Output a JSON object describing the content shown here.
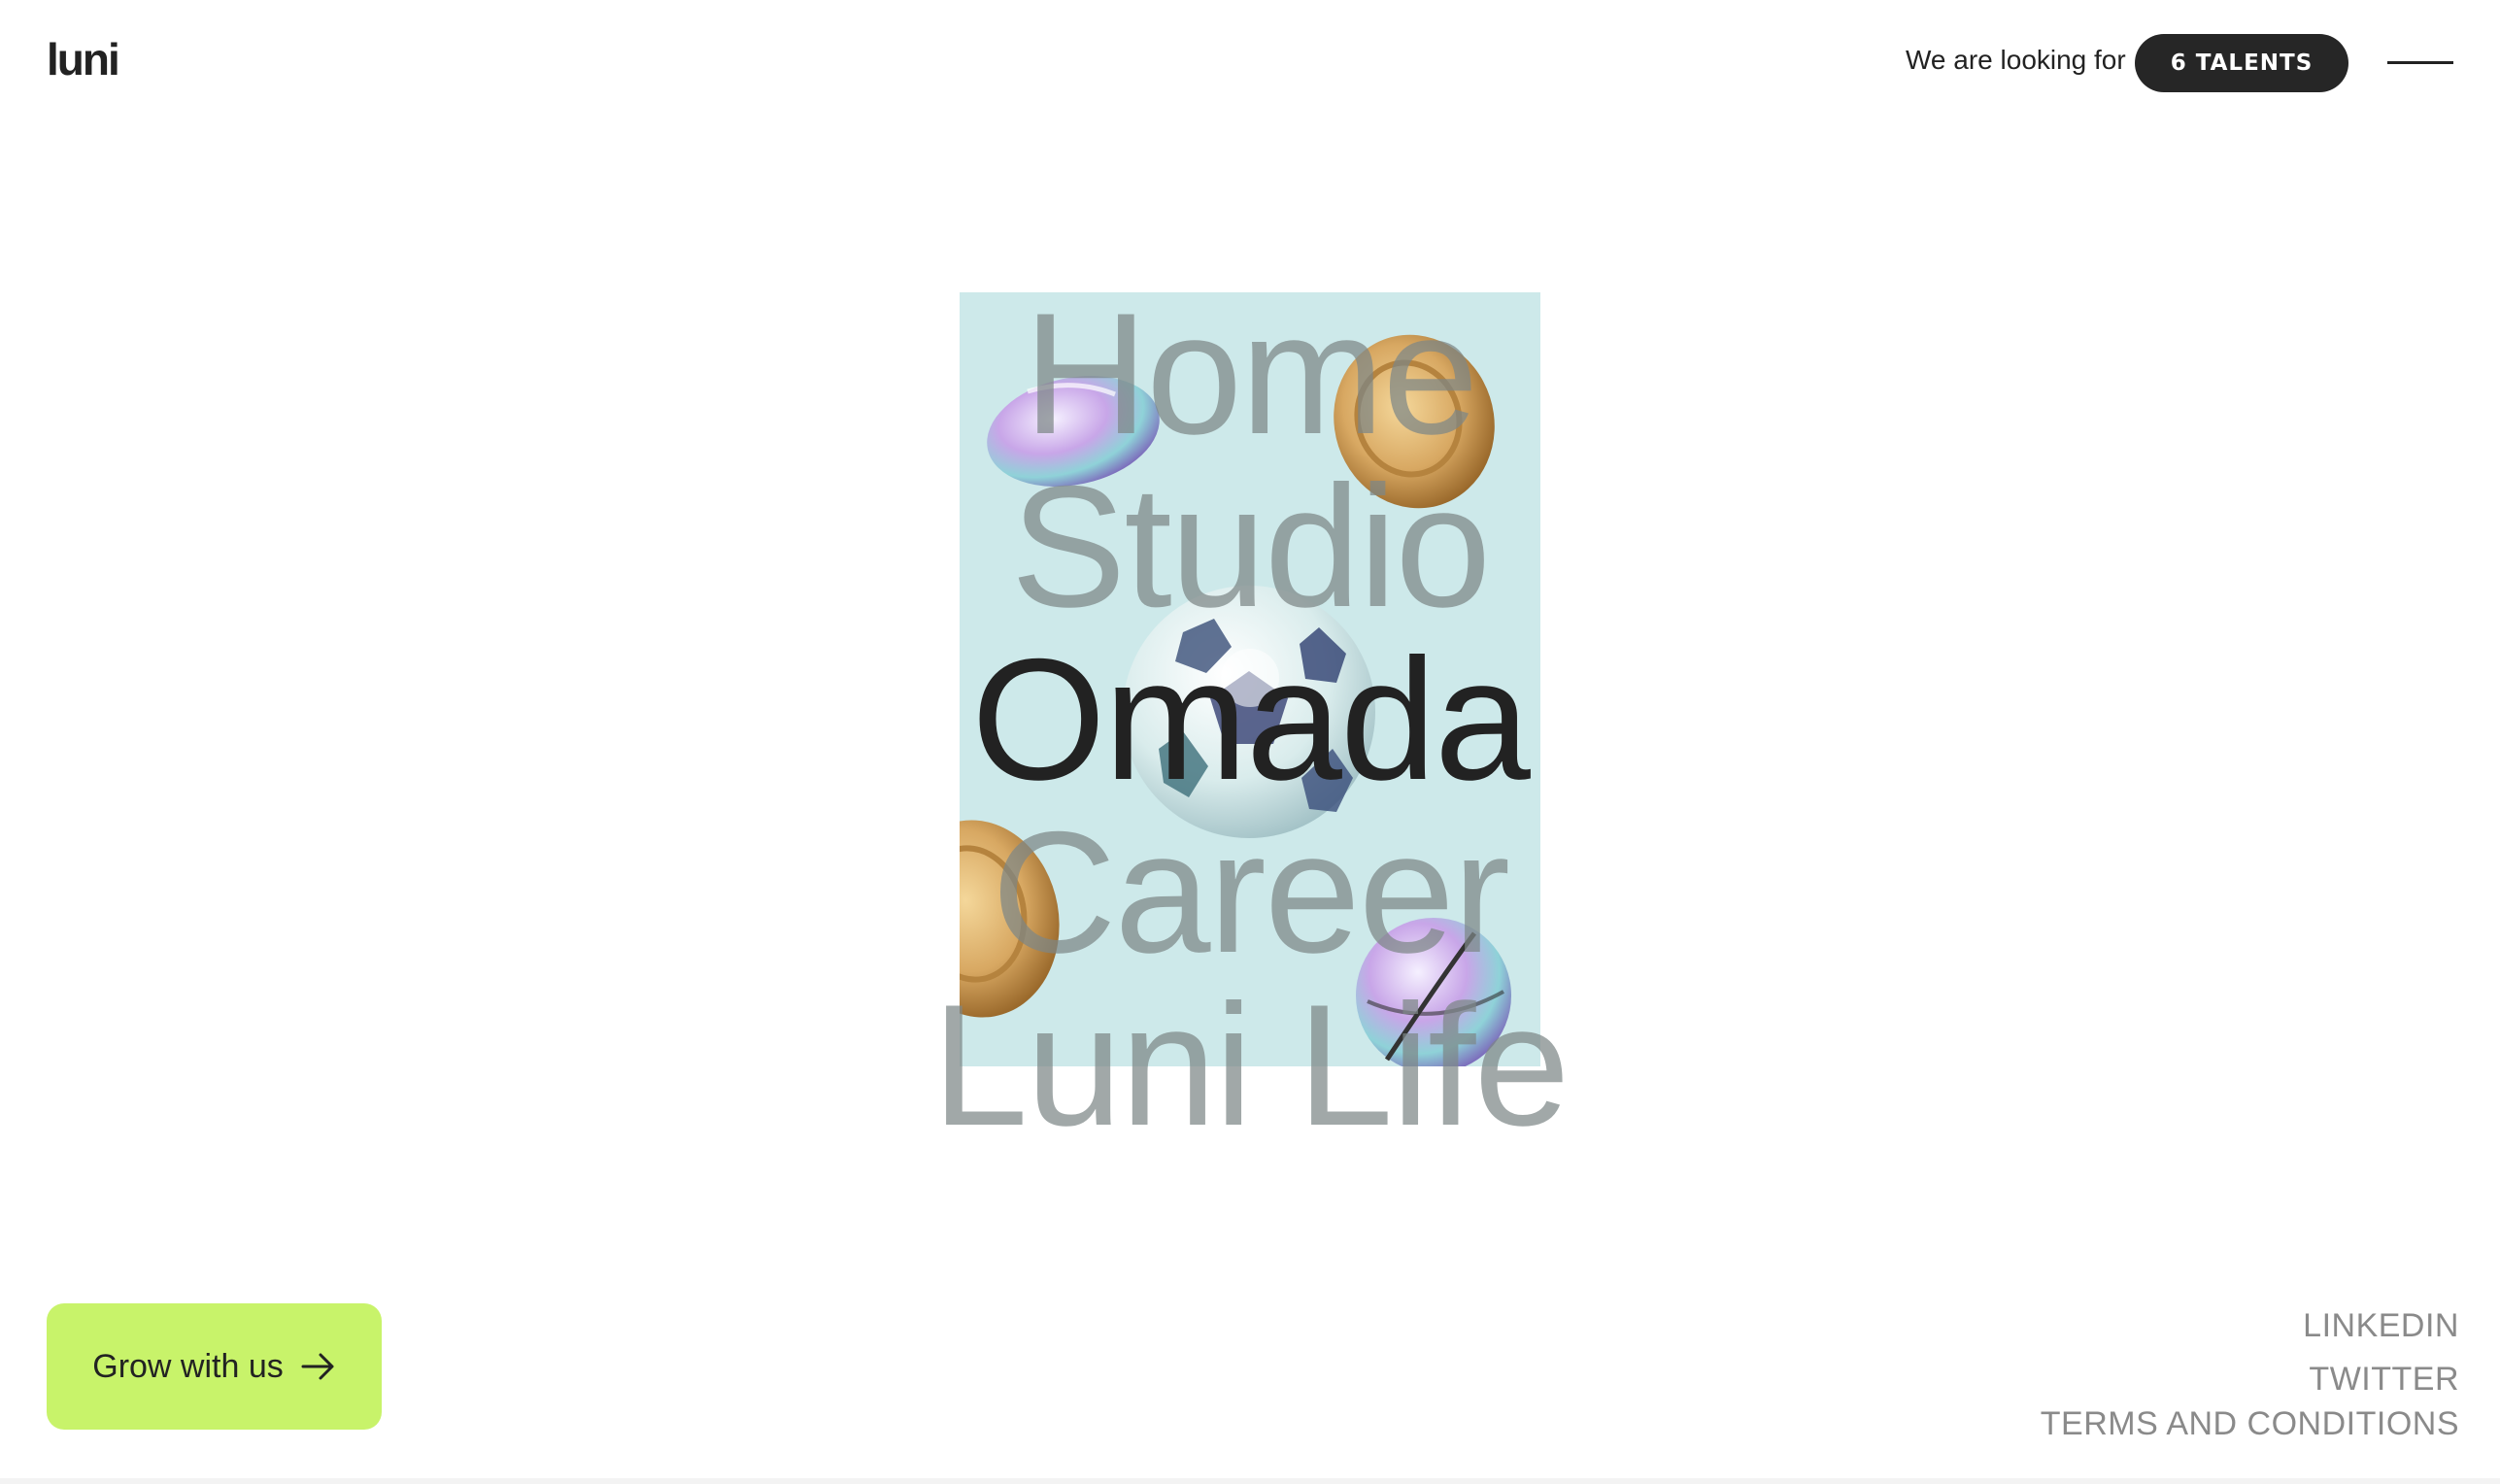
{
  "header": {
    "logo": "luni",
    "hiring_text": "We are looking for",
    "talents_button": "6 TALENTS",
    "menu_icon": "hamburger-icon"
  },
  "nav": {
    "items": [
      {
        "label": "Home",
        "active": false
      },
      {
        "label": "Studio",
        "active": false
      },
      {
        "label": "Omada",
        "active": true
      },
      {
        "label": "Career",
        "active": false
      },
      {
        "label": "Luni Life",
        "active": false
      }
    ]
  },
  "media": {
    "play_icon": "play-icon",
    "background": "#cde9ea"
  },
  "cta": {
    "label": "Grow with us",
    "icon": "arrow-right-icon",
    "color": "#c8f36a"
  },
  "footer": {
    "links": [
      "LINKEDIN",
      "TWITTER",
      "TERMS AND CONDITIONS"
    ]
  }
}
